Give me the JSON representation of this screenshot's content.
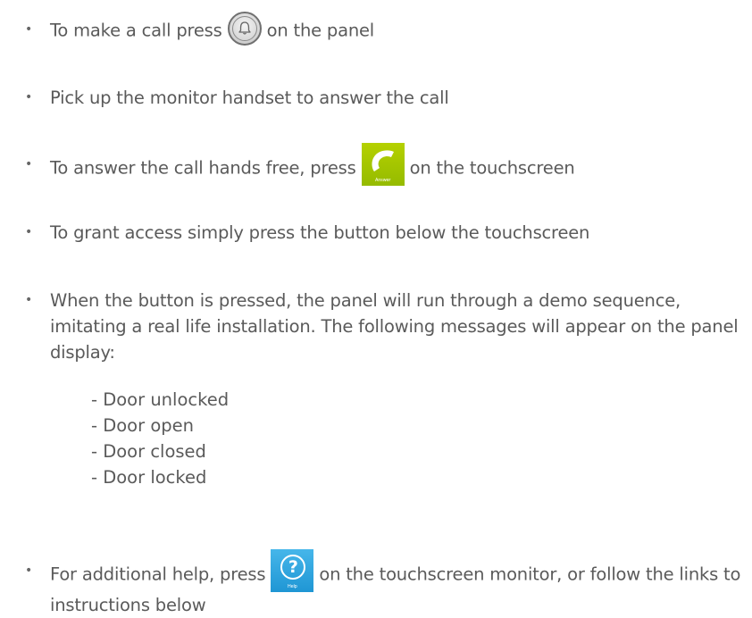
{
  "instructions": {
    "call": {
      "before": "To make a call press",
      "after": "on the panel",
      "icon": "bell-icon"
    },
    "handset": {
      "text": "Pick up the monitor handset to answer the call"
    },
    "handsfree": {
      "before": "To answer the call hands free, press",
      "after": "on the touchscreen",
      "icon": "phone-icon",
      "button_label": "Answer",
      "button_color": "#a5c800"
    },
    "access": {
      "text": "To grant access simply press the button below the touchscreen"
    },
    "demo": {
      "text": "When the button is pressed, the panel will run through a demo sequence, imitating a real life installation. The following messages will appear on the panel display:",
      "messages": [
        "- Door unlocked",
        "- Door open",
        "- Door closed",
        "- Door locked"
      ]
    },
    "help": {
      "before": "For additional help, press",
      "after": "on the touchscreen monitor, or follow the links to instructions below",
      "icon": "question-icon",
      "button_label": "Help",
      "button_color": "#2fa6df"
    }
  },
  "bullet_char": "•"
}
